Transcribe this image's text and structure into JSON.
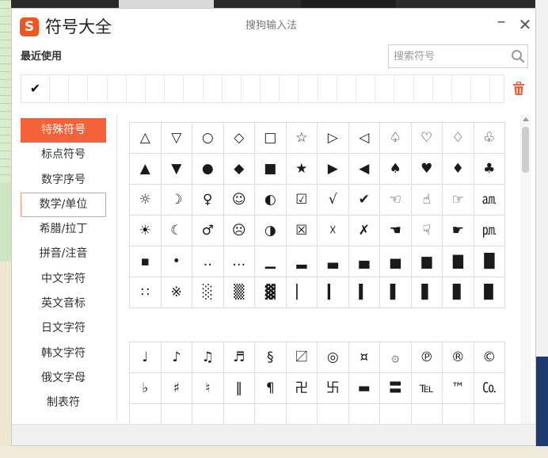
{
  "window": {
    "logo_letter": "S",
    "title": "符号大全",
    "app_name": "搜狗输入法",
    "minimize_glyph": "–",
    "close_glyph": "✕"
  },
  "recent": {
    "label": "最近使用",
    "items": [
      "✔",
      "",
      "",
      "",
      "",
      "",
      "",
      "",
      "",
      "",
      "",
      "",
      "",
      "",
      "",
      "",
      "",
      "",
      "",
      "",
      "",
      "",
      "",
      ""
    ]
  },
  "search": {
    "placeholder": "搜索符号",
    "value": ""
  },
  "categories": {
    "items": [
      {
        "label": "特殊符号",
        "state": "active"
      },
      {
        "label": "标点符号",
        "state": ""
      },
      {
        "label": "数字序号",
        "state": ""
      },
      {
        "label": "数学/单位",
        "state": "hover"
      },
      {
        "label": "希腊/拉丁",
        "state": ""
      },
      {
        "label": "拼音/注音",
        "state": ""
      },
      {
        "label": "中文字符",
        "state": ""
      },
      {
        "label": "英文音标",
        "state": ""
      },
      {
        "label": "日文字符",
        "state": ""
      },
      {
        "label": "韩文字符",
        "state": ""
      },
      {
        "label": "俄文字母",
        "state": ""
      },
      {
        "label": "制表符",
        "state": ""
      }
    ]
  },
  "symbols_grid_1": [
    "△",
    "▽",
    "○",
    "◇",
    "□",
    "☆",
    "▷",
    "◁",
    "♤",
    "♡",
    "♢",
    "♧",
    "▲",
    "▼",
    "●",
    "◆",
    "■",
    "★",
    "▶",
    "◀",
    "♠",
    "♥",
    "♦",
    "♣",
    "☼",
    "☽",
    "♀",
    "☺",
    "◐",
    "☑",
    "√",
    "✔",
    "☜",
    "☝",
    "☞",
    "㏂",
    "☀",
    "☾",
    "♂",
    "☹",
    "◑",
    "☒",
    "☓",
    "✗",
    "☚",
    "☟",
    "☛",
    "㏘",
    "▪",
    "•",
    "‥",
    "…",
    "▁",
    "▂",
    "▃",
    "▄",
    "▅",
    "▆",
    "▇",
    "█",
    "∷",
    "※",
    "░",
    "▒",
    "▓",
    "▏",
    "▎",
    "▍",
    "▌",
    "▋",
    "▊",
    "▉"
  ],
  "symbols_grid_2": [
    "♩",
    "♪",
    "♫",
    "♬",
    "§",
    "〼",
    "◎",
    "¤",
    "۞",
    "℗",
    "®",
    "©",
    "♭",
    "♯",
    "♮",
    "‖",
    "¶",
    "卍",
    "卐",
    "▬",
    "〓",
    "℡",
    "™",
    "㏇",
    "",
    "",
    "",
    "",
    "",
    "",
    "",
    "",
    "",
    "",
    "",
    ""
  ],
  "colors": {
    "accent": "#f4623a",
    "logo": "#f2551d"
  }
}
